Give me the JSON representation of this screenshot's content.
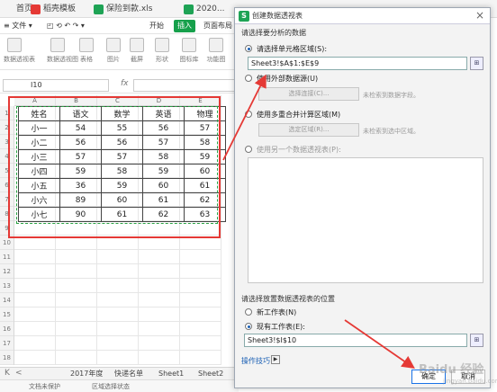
{
  "tabs": [
    {
      "label": "首页",
      "color": "#ffffff"
    },
    {
      "label": "稻壳模板",
      "color": "#e53935"
    },
    {
      "label": "保险到款.xls",
      "color": "#1ea355"
    },
    {
      "label": "2020...",
      "color": "#1ea355"
    }
  ],
  "menu": {
    "items": [
      "≡ 文件 ▾",
      "开始",
      "插入",
      "页面布局"
    ],
    "icons_row": [
      "◰",
      "⟲",
      "↶",
      "↷",
      "▾"
    ]
  },
  "ribbon": [
    {
      "label": "数据透视表"
    },
    {
      "label": "数据透视图"
    },
    {
      "label": "表格"
    },
    {
      "label": "图片"
    },
    {
      "label": "截屏"
    },
    {
      "label": "形状"
    },
    {
      "label": "图标库"
    },
    {
      "label": "功能图"
    }
  ],
  "formula_bar": {
    "name_box": "I10",
    "fx": "fx",
    "value": ""
  },
  "grid": {
    "columns": [
      "A",
      "B",
      "C",
      "D",
      "E"
    ],
    "rows": [
      "1",
      "2",
      "3",
      "4",
      "5",
      "6",
      "7",
      "8",
      "9",
      "10",
      "11",
      "12",
      "13",
      "14",
      "15",
      "16",
      "17",
      "18"
    ],
    "table": [
      [
        "姓名",
        "语文",
        "数学",
        "英语",
        "物理"
      ],
      [
        "小一",
        "54",
        "55",
        "56",
        "57"
      ],
      [
        "小二",
        "56",
        "56",
        "57",
        "58"
      ],
      [
        "小三",
        "57",
        "57",
        "58",
        "59"
      ],
      [
        "小四",
        "59",
        "58",
        "59",
        "60"
      ],
      [
        "小五",
        "36",
        "59",
        "60",
        "61"
      ],
      [
        "小六",
        "89",
        "60",
        "61",
        "62"
      ],
      [
        "小七",
        "90",
        "61",
        "62",
        "63"
      ]
    ]
  },
  "sheet_tabs": [
    "2017年度",
    "快递名单",
    "Sheet1",
    "Sheet2"
  ],
  "nav": {
    "first": "K",
    "prev": "<"
  },
  "status": [
    "文档未保护",
    "区域选择状态"
  ],
  "dialog": {
    "title": "创建数据透视表",
    "close": "×",
    "logo": "S",
    "section1": "请选择要分析的数据",
    "opt_range": "请选择单元格区域(S):",
    "range_value": "Sheet3!$A$1:$E$9",
    "opt_external": "使用外部数据源(U)",
    "choose_conn": "选择连接(C)...",
    "no_field": "未检索到数据字段。",
    "opt_multi": "使用多重合并计算区域(M)",
    "choose_area": "选定区域(R)...",
    "no_area": "未检索到选中区域。",
    "opt_other": "使用另一个数据透视表(P):",
    "section2": "请选择放置数据透视表的位置",
    "opt_new": "新工作表(N)",
    "opt_existing": "现有工作表(E):",
    "existing_value": "Sheet3!$I$10",
    "tips": "操作技巧",
    "ok": "确定",
    "cancel": "取消",
    "picker": "⊞"
  },
  "watermark": {
    "main": "Baidu 经验",
    "sub": "jingyan.baidu.com"
  }
}
